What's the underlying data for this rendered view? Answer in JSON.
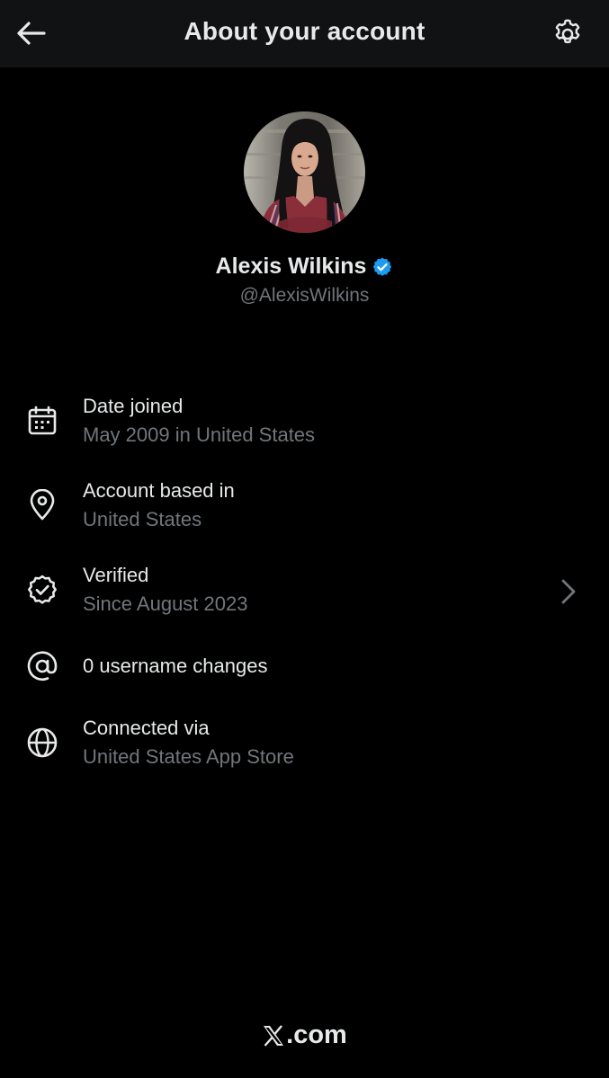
{
  "header": {
    "title": "About your account",
    "back_icon": "arrow-left-icon",
    "settings_icon": "gear-icon"
  },
  "profile": {
    "name": "Alexis Wilkins",
    "handle": "@AlexisWilkins",
    "verified_badge_color": "#1d9bf0"
  },
  "details": [
    {
      "icon": "calendar-icon",
      "label": "Date joined",
      "value": "May 2009 in United States"
    },
    {
      "icon": "location-pin-icon",
      "label": "Account based in",
      "value": "United States"
    },
    {
      "icon": "verified-icon",
      "label": "Verified",
      "value": "Since August 2023"
    },
    {
      "icon": "at-sign-icon",
      "label": "0 username changes"
    },
    {
      "icon": "globe-icon",
      "label": "Connected via",
      "value": "United States App Store"
    }
  ],
  "footer": {
    "brand_suffix": ".com"
  },
  "colors": {
    "background": "#000000",
    "header_background": "#111214",
    "primary_text": "#e7e9ea",
    "secondary_text": "#71767b",
    "accent": "#1d9bf0"
  }
}
